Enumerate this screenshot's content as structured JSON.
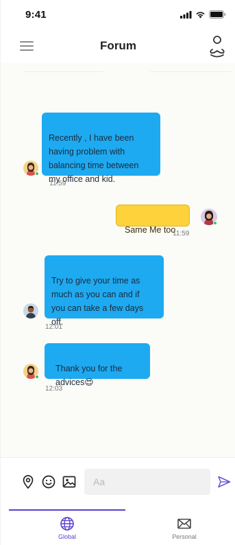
{
  "status_bar": {
    "time": "9:41"
  },
  "header": {
    "title": "Forum"
  },
  "messages": [
    {
      "sender": "other",
      "text": "Recently , I have been\nhaving problem with\nbalancing time between\nmy office and kid.",
      "time": "11:59",
      "color": "#1eaaf1"
    },
    {
      "sender": "me",
      "text": "Same Me too",
      "time": "11:59",
      "color": "#fdd23a"
    },
    {
      "sender": "other",
      "text": "Try to give your time as\nmuch as you can and if\nyou can take a few days\noff.",
      "time": "12:01",
      "color": "#1eaaf1"
    },
    {
      "sender": "other",
      "text": "Thank you for the\nadvices",
      "emoji": "😍",
      "time": "12:03",
      "color": "#1eaaf1"
    }
  ],
  "composer": {
    "placeholder": "Aa"
  },
  "nav": {
    "items": [
      {
        "label": "Global",
        "icon": "globe-icon",
        "active": true
      },
      {
        "label": "Personal",
        "icon": "mail-icon",
        "active": false
      }
    ],
    "active_color": "#5b3fd0"
  }
}
